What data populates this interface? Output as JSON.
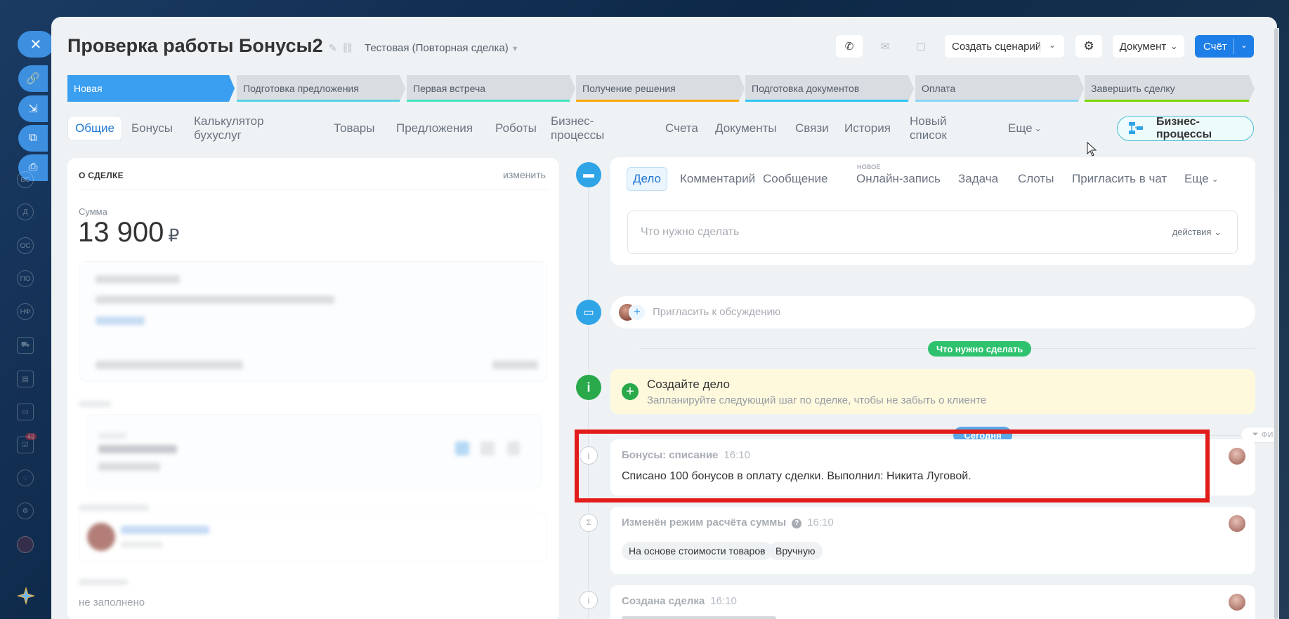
{
  "colors": {
    "accent": "#3a9ff0",
    "success": "#2fc26e",
    "highlight": "#e21b1b",
    "warning_bg": "#fef8dd"
  },
  "sidebar": {
    "icons": [
      "link-icon",
      "import-icon",
      "open-external-icon",
      "print-icon"
    ],
    "items": [
      "ВС",
      "Д",
      "ОС",
      "ПО",
      "НФ"
    ],
    "badge": "43"
  },
  "header": {
    "title": "Проверка работы Бонусы2",
    "category": "Тестовая (Повторная сделка)",
    "scenario_button": "Создать сценарий",
    "document_button": "Документ",
    "invoice_button": "Счёт"
  },
  "stages": [
    {
      "label": "Новая",
      "active": true
    },
    {
      "label": "Подготовка предложения"
    },
    {
      "label": "Первая встреча"
    },
    {
      "label": "Получение решения"
    },
    {
      "label": "Подготовка документов"
    },
    {
      "label": "Оплата"
    },
    {
      "label": "Завершить сделку"
    }
  ],
  "tabs": [
    "Общие",
    "Бонусы",
    "Калькулятор бухуслуг",
    "Товары",
    "Предложения",
    "Роботы",
    "Бизнес-процессы",
    "Счета",
    "Документы",
    "Связи",
    "История",
    "Новый список",
    "Еще"
  ],
  "bp_button": "Бизнес-процессы",
  "about": {
    "title": "О СДЕЛКЕ",
    "edit": "изменить",
    "sum_label": "Сумма",
    "sum_value": "13 900",
    "currency": "₽",
    "not_filled": "не заполнено"
  },
  "editor": {
    "tabs": [
      "Дело",
      "Комментарий",
      "Сообщение",
      "Онлайн-запись",
      "Задача",
      "Слоты",
      "Пригласить в чат",
      "Еще"
    ],
    "new_badge": "НОВОЕ",
    "placeholder": "Что нужно сделать",
    "actions": "действия"
  },
  "invite_placeholder": "Пригласить к обсуждению",
  "todo_label": "Что нужно сделать",
  "create_card": {
    "title": "Создайте дело",
    "subtitle": "Запланируйте следующий шаг по сделке, чтобы не забыть о клиенте"
  },
  "today_label": "Сегодня",
  "filter_label": "ФИЛЬТР",
  "events": [
    {
      "title": "Бонусы: списание",
      "time": "16:10",
      "body": "Списано 100 бонусов в оплату сделки. Выполнил: Никита Луговой."
    },
    {
      "title": "Изменён режим расчёта суммы",
      "time": "16:10",
      "from": "На основе стоимости товаров",
      "to": "Вручную"
    },
    {
      "title": "Создана сделка",
      "time": "16:10"
    }
  ]
}
